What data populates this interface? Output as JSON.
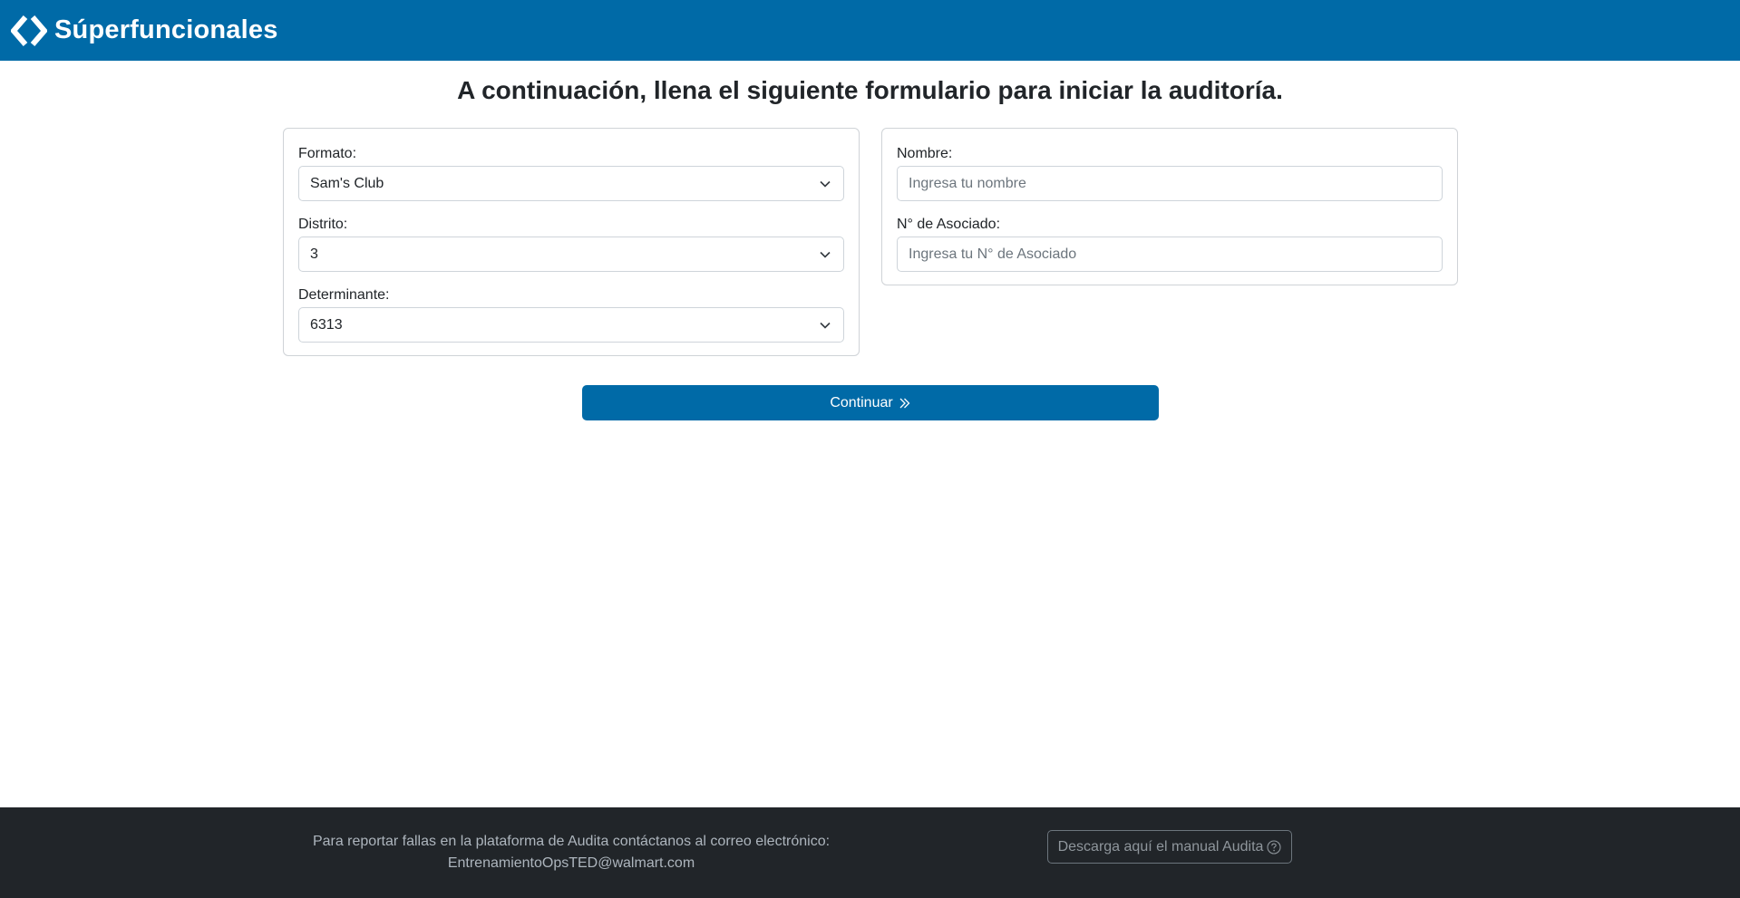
{
  "header": {
    "brand_name": "Súperfuncionales",
    "logo_icon": "diamond-chevrons-logo"
  },
  "main": {
    "title": "A continuación, llena el siguiente formulario para iniciar la auditoría."
  },
  "form_left": {
    "formato": {
      "label": "Formato:",
      "value": "Sam's Club"
    },
    "distrito": {
      "label": "Distrito:",
      "value": "3"
    },
    "determinante": {
      "label": "Determinante:",
      "value": "6313"
    }
  },
  "form_right": {
    "nombre": {
      "label": "Nombre:",
      "value": "",
      "placeholder": "Ingresa tu nombre"
    },
    "asociado": {
      "label": "N° de Asociado:",
      "value": "",
      "placeholder": "Ingresa tu N° de Asociado"
    }
  },
  "actions": {
    "continue_label": "Continuar"
  },
  "footer": {
    "report_text": "Para reportar fallas en la plataforma de Audita contáctanos al correo electrónico:",
    "email": "EntrenamientoOpsTED@walmart.com",
    "manual_label": "Descarga aquí el manual Audita"
  },
  "colors": {
    "primary": "#006aa7",
    "footer_bg": "#212529",
    "text": "#212529",
    "muted": "#adb5bd"
  }
}
